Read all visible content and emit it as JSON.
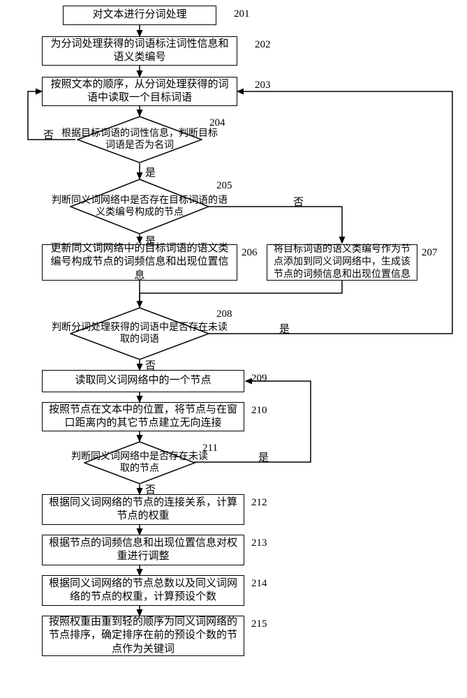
{
  "steps": {
    "s201": "对文本进行分词处理",
    "s202": "为分词处理获得的词语标注词性信息和语义类编号",
    "s203": "按照文本的顺序，从分词处理获得的词语中读取一个目标词语",
    "s204": "根据目标词语的词性信息，判断目标词语是否为名词",
    "s205": "判断同义词网络中是否存在目标词语的语义类编号构成的节点",
    "s206": "更新同义词网络中的目标词语的语义类编号构成节点的词频信息和出现位置信息",
    "s207": "将目标词语的语义类编号作为节点添加到同义词网络中，生成该节点的词频信息和出现位置信息",
    "s208": "判断分词处理获得的词语中是否存在未读取的词语",
    "s209": "读取同义词网络中的一个节点",
    "s210": "按照节点在文本中的位置，将节点与在窗口距离内的其它节点建立无向连接",
    "s211": "判断同义词网络中是否存在未读取的节点",
    "s212": "根据同义词网络的节点的连接关系，计算节点的权重",
    "s213": "根据节点的词频信息和出现位置信息对权重进行调整",
    "s214": "根据同义词网络的节点总数以及同义词网络的节点的权重，计算预设个数",
    "s215": "按照权重由重到轻的顺序为同义词网络的节点排序，确定排序在前的预设个数的节点作为关键词"
  },
  "labels": {
    "n201": "201",
    "n202": "202",
    "n203": "203",
    "n204": "204",
    "n205": "205",
    "n206": "206",
    "n207": "207",
    "n208": "208",
    "n209": "209",
    "n210": "210",
    "n211": "211",
    "n212": "212",
    "n213": "213",
    "n214": "214",
    "n215": "215"
  },
  "branches": {
    "yes": "是",
    "no": "否"
  }
}
